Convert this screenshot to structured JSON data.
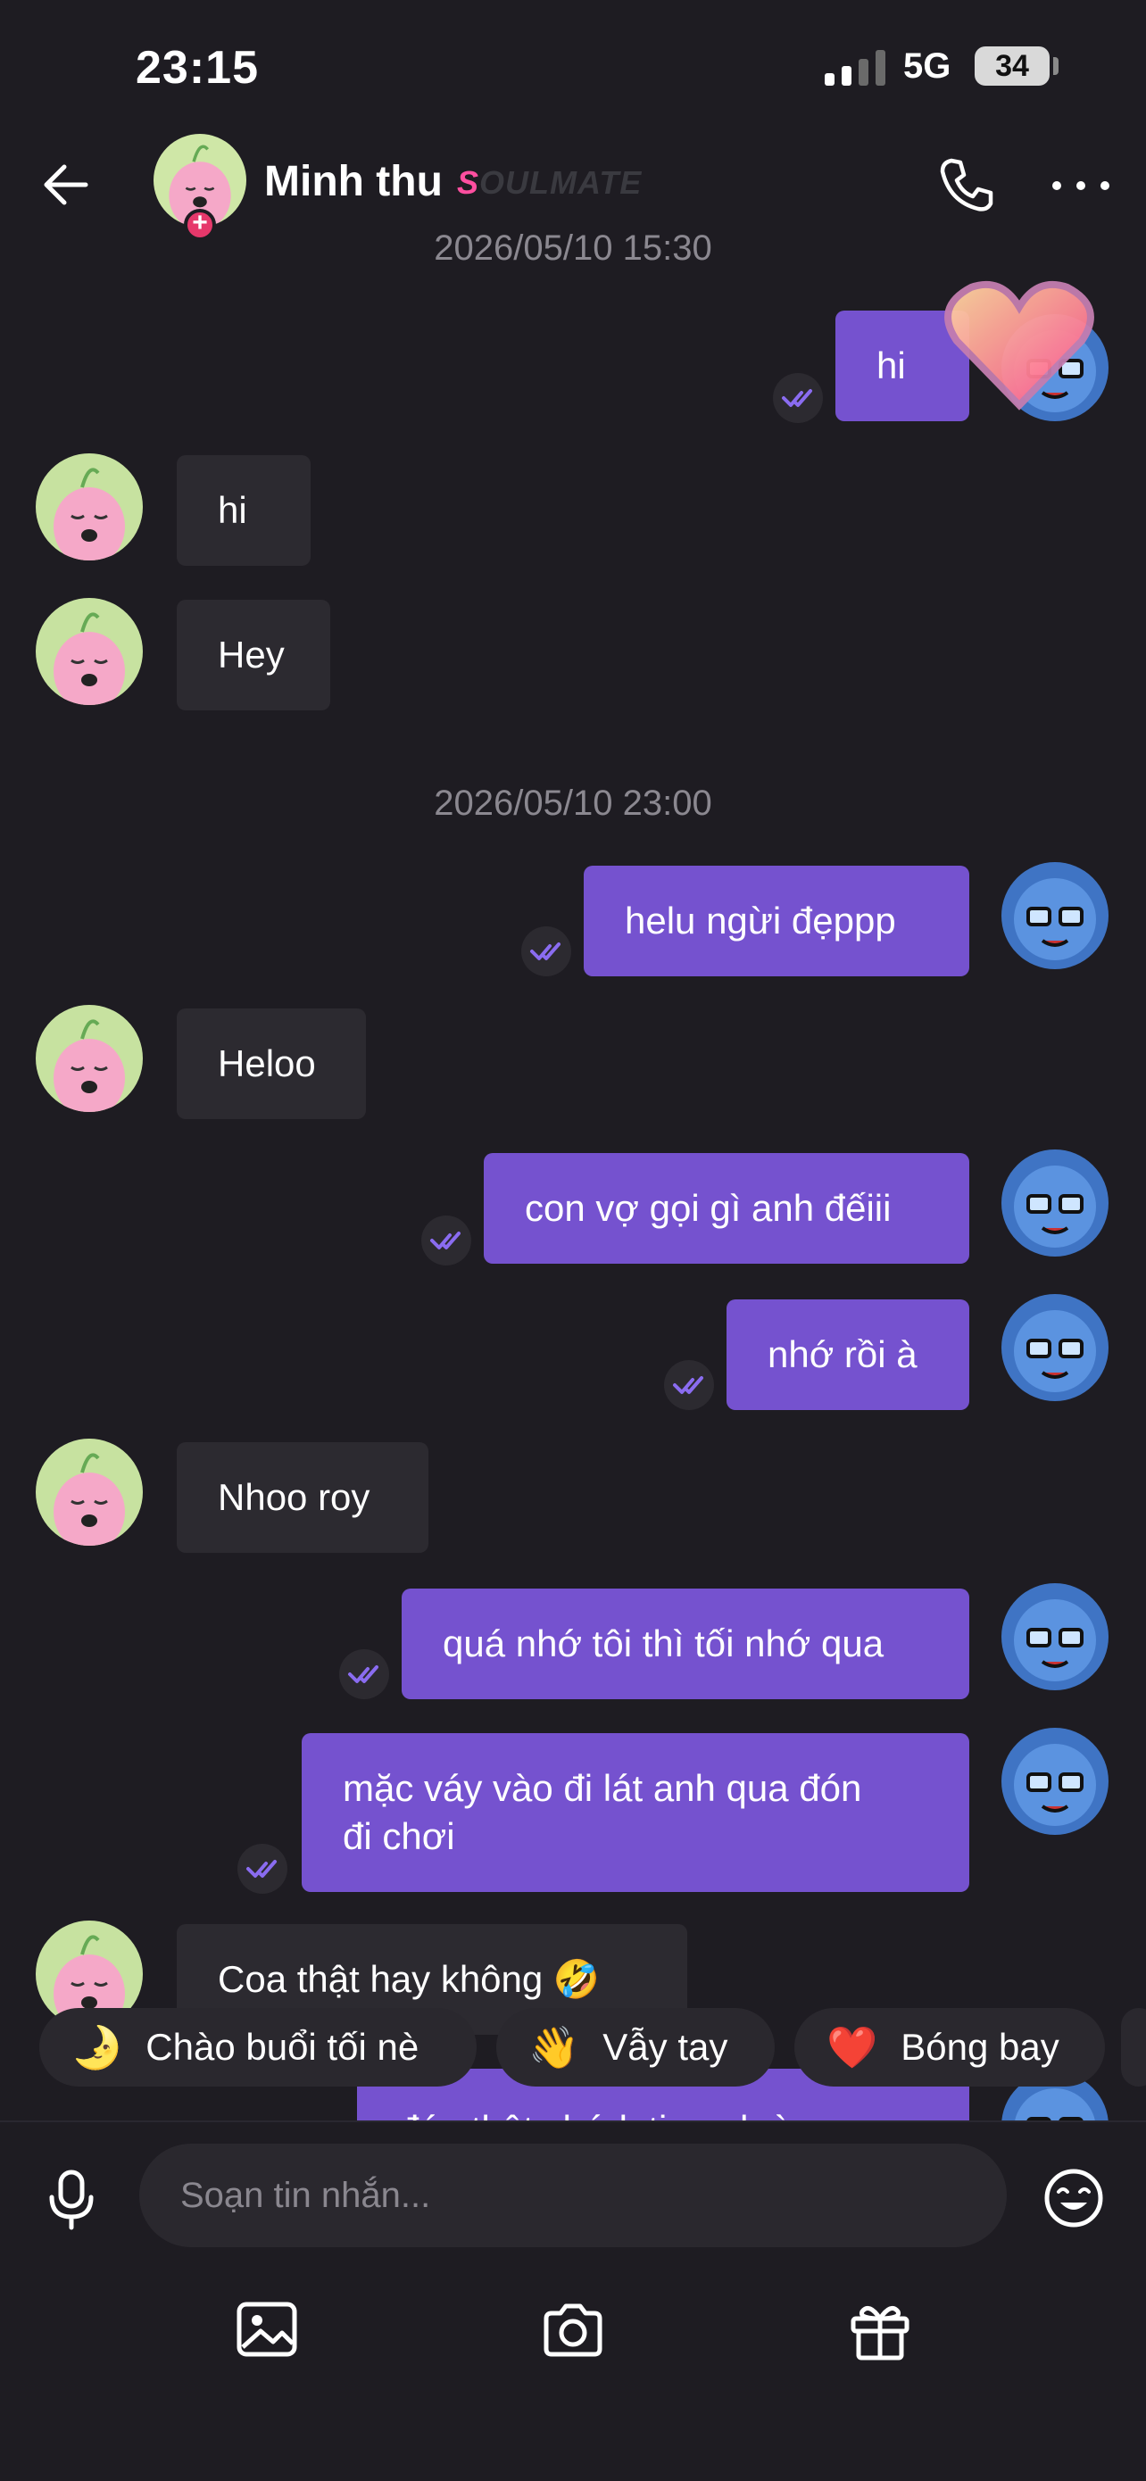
{
  "status_bar": {
    "time": "23:15",
    "network": "5G",
    "battery": "34"
  },
  "header": {
    "name": "Minh thu",
    "tag_first": "S",
    "tag_rest": "OULMATE",
    "badge": "+"
  },
  "timestamps": [
    "2026/05/10 15:30",
    "2026/05/10 23:00"
  ],
  "messages": [
    {
      "from": "me",
      "text": "hi"
    },
    {
      "from": "them",
      "text": "hi"
    },
    {
      "from": "them",
      "text": "Hey"
    },
    {
      "from": "me",
      "text": "helu ngừi đẹppp"
    },
    {
      "from": "them",
      "text": "Heloo"
    },
    {
      "from": "me",
      "text": "con vợ gọi gì anh đếiii"
    },
    {
      "from": "me",
      "text": "nhớ rồi à"
    },
    {
      "from": "them",
      "text": "Nhoo roy"
    },
    {
      "from": "me",
      "text": "quá nhớ tôi thì tối nhớ qua"
    },
    {
      "from": "me",
      "text": "mặc váy vào đi lát anh qua đón\nđi chơi"
    },
    {
      "from": "them",
      "text": "Coa thật hay không 🤣"
    },
    {
      "from": "me",
      "text": "đón thật chứ k tin anh à con"
    }
  ],
  "quick_replies": [
    {
      "emoji": "🌛",
      "label": "Chào buổi tối nè"
    },
    {
      "emoji": "👋",
      "label": "Vẫy tay"
    },
    {
      "emoji": "❤️",
      "label": "Bóng bay"
    }
  ],
  "composer": {
    "placeholder": "Soạn tin nhắn..."
  },
  "colors": {
    "background": "#1e1c22",
    "outgoing": "#7552cf",
    "incoming": "#2c2a30",
    "accent": "#8a6cf0"
  }
}
